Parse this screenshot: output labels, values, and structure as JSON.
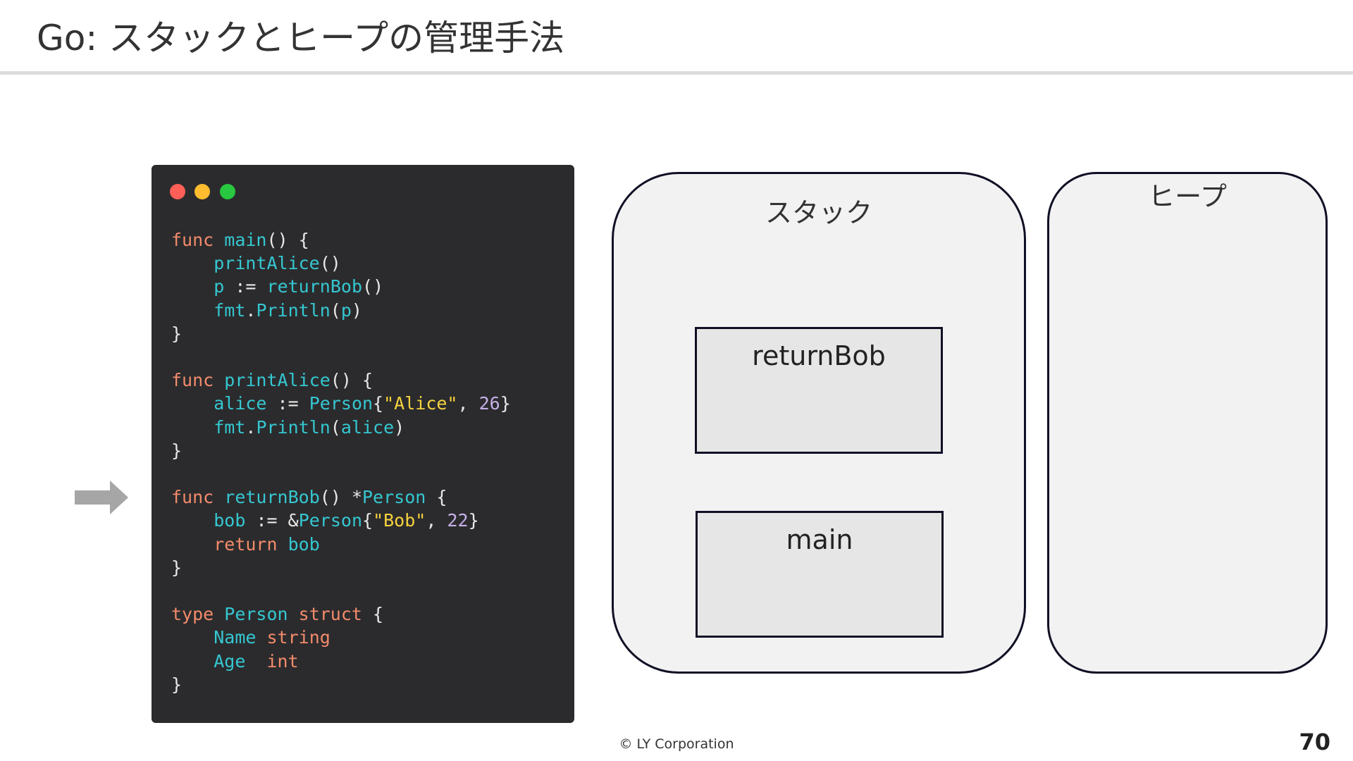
{
  "slide": {
    "title": "Go: スタックとヒープの管理手法",
    "footer": "© LY Corporation",
    "page_number": "70"
  },
  "code_window": {
    "dot_colors": [
      "#fe5f57",
      "#febc2e",
      "#28c840"
    ],
    "code_lines": [
      "func main() {",
      "    printAlice()",
      "    p := returnBob()",
      "    fmt.Println(p)",
      "}",
      "",
      "func printAlice() {",
      "    alice := Person{\"Alice\", 26}",
      "    fmt.Println(alice)",
      "}",
      "",
      "func returnBob() *Person {",
      "    bob := &Person{\"Bob\", 22}",
      "    return bob",
      "}",
      "",
      "type Person struct {",
      "    Name string",
      "    Age  int",
      "}"
    ],
    "current_line_index": 11,
    "current_line_marker_icon": "right-arrow-icon"
  },
  "memory": {
    "stack_label": "スタック",
    "heap_label": "ヒープ",
    "stack_frames": [
      {
        "label": "returnBob"
      },
      {
        "label": "main"
      }
    ]
  }
}
